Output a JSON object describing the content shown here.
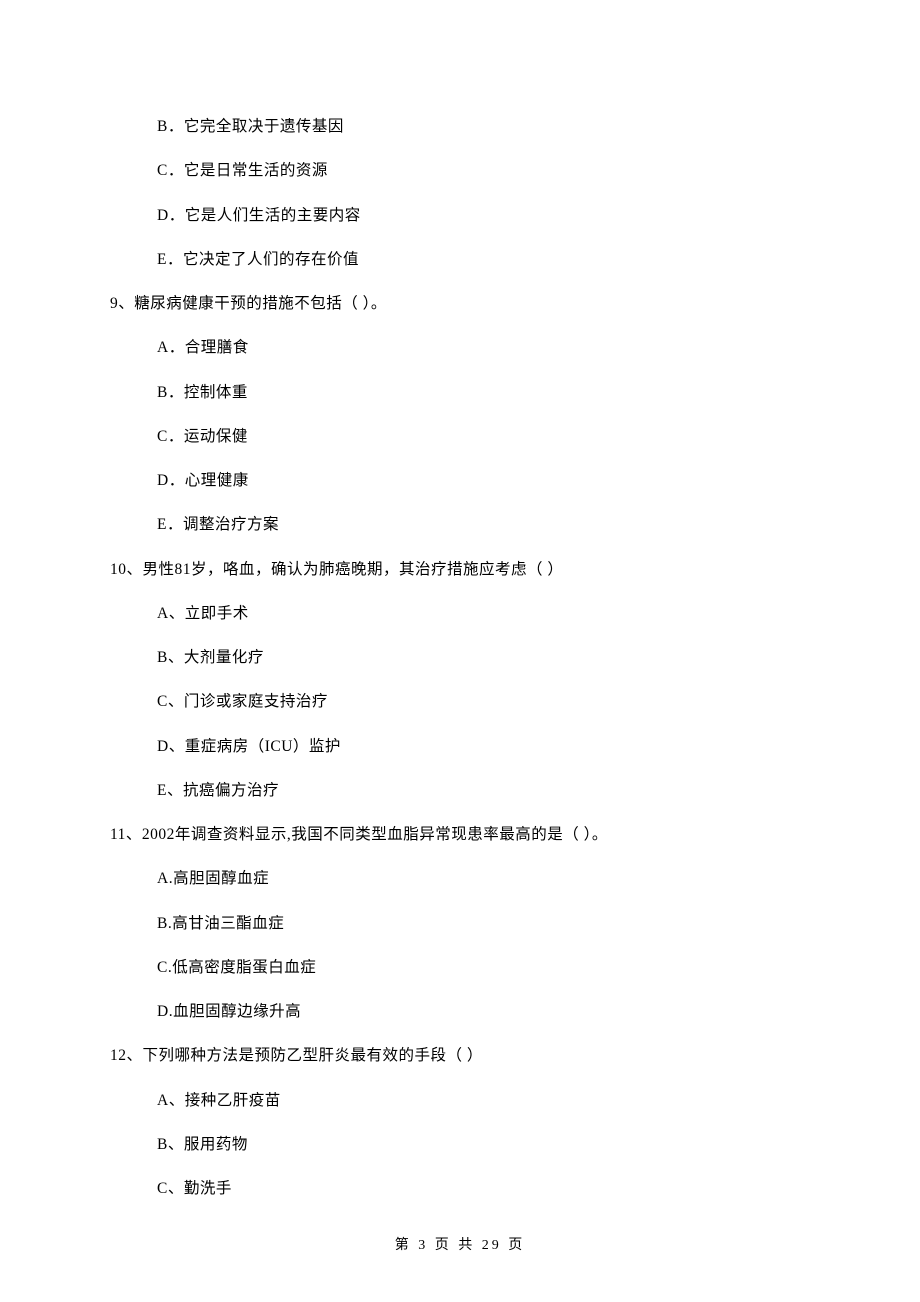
{
  "options_prev": [
    "B．它完全取决于遗传基因",
    "C．它是日常生活的资源",
    "D．它是人们生活的主要内容",
    "E．它决定了人们的存在价值"
  ],
  "q9": {
    "stem": "9、糖尿病健康干预的措施不包括（     ）。",
    "opts": [
      "A．合理膳食",
      "B．控制体重",
      "C．运动保健",
      "D．心理健康",
      "E．调整治疗方案"
    ]
  },
  "q10": {
    "stem": "10、男性81岁，咯血，确认为肺癌晚期，其治疗措施应考虑（     ）",
    "opts": [
      "A、立即手术",
      "B、大剂量化疗",
      "C、门诊或家庭支持治疗",
      "D、重症病房（ICU）监护",
      "E、抗癌偏方治疗"
    ]
  },
  "q11": {
    "stem": "11、2002年调查资料显示,我国不同类型血脂异常现患率最高的是（     ）。",
    "opts": [
      "A.高胆固醇血症",
      "B.高甘油三酯血症",
      "C.低高密度脂蛋白血症",
      "D.血胆固醇边缘升高"
    ]
  },
  "q12": {
    "stem": "12、下列哪种方法是预防乙型肝炎最有效的手段（    ）",
    "opts": [
      "A、接种乙肝疫苗",
      "B、服用药物",
      "C、勤洗手"
    ]
  },
  "footer": "第 3 页 共 29 页"
}
